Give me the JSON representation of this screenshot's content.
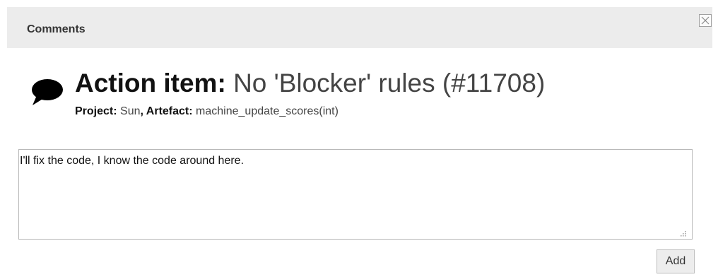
{
  "header": {
    "title": "Comments",
    "close_icon": "close-icon"
  },
  "item": {
    "icon": "speech-bubble-icon",
    "prefix": "Action item:",
    "name": "No 'Blocker' rules (#11708)",
    "project_label": "Project:",
    "project_value": "Sun",
    "artefact_separator": ", ",
    "artefact_label": "Artefact:",
    "artefact_value": "machine_update_scores(int)"
  },
  "comment": {
    "value": "I'll fix the code, I know the code around here."
  },
  "actions": {
    "add_label": "Add"
  }
}
